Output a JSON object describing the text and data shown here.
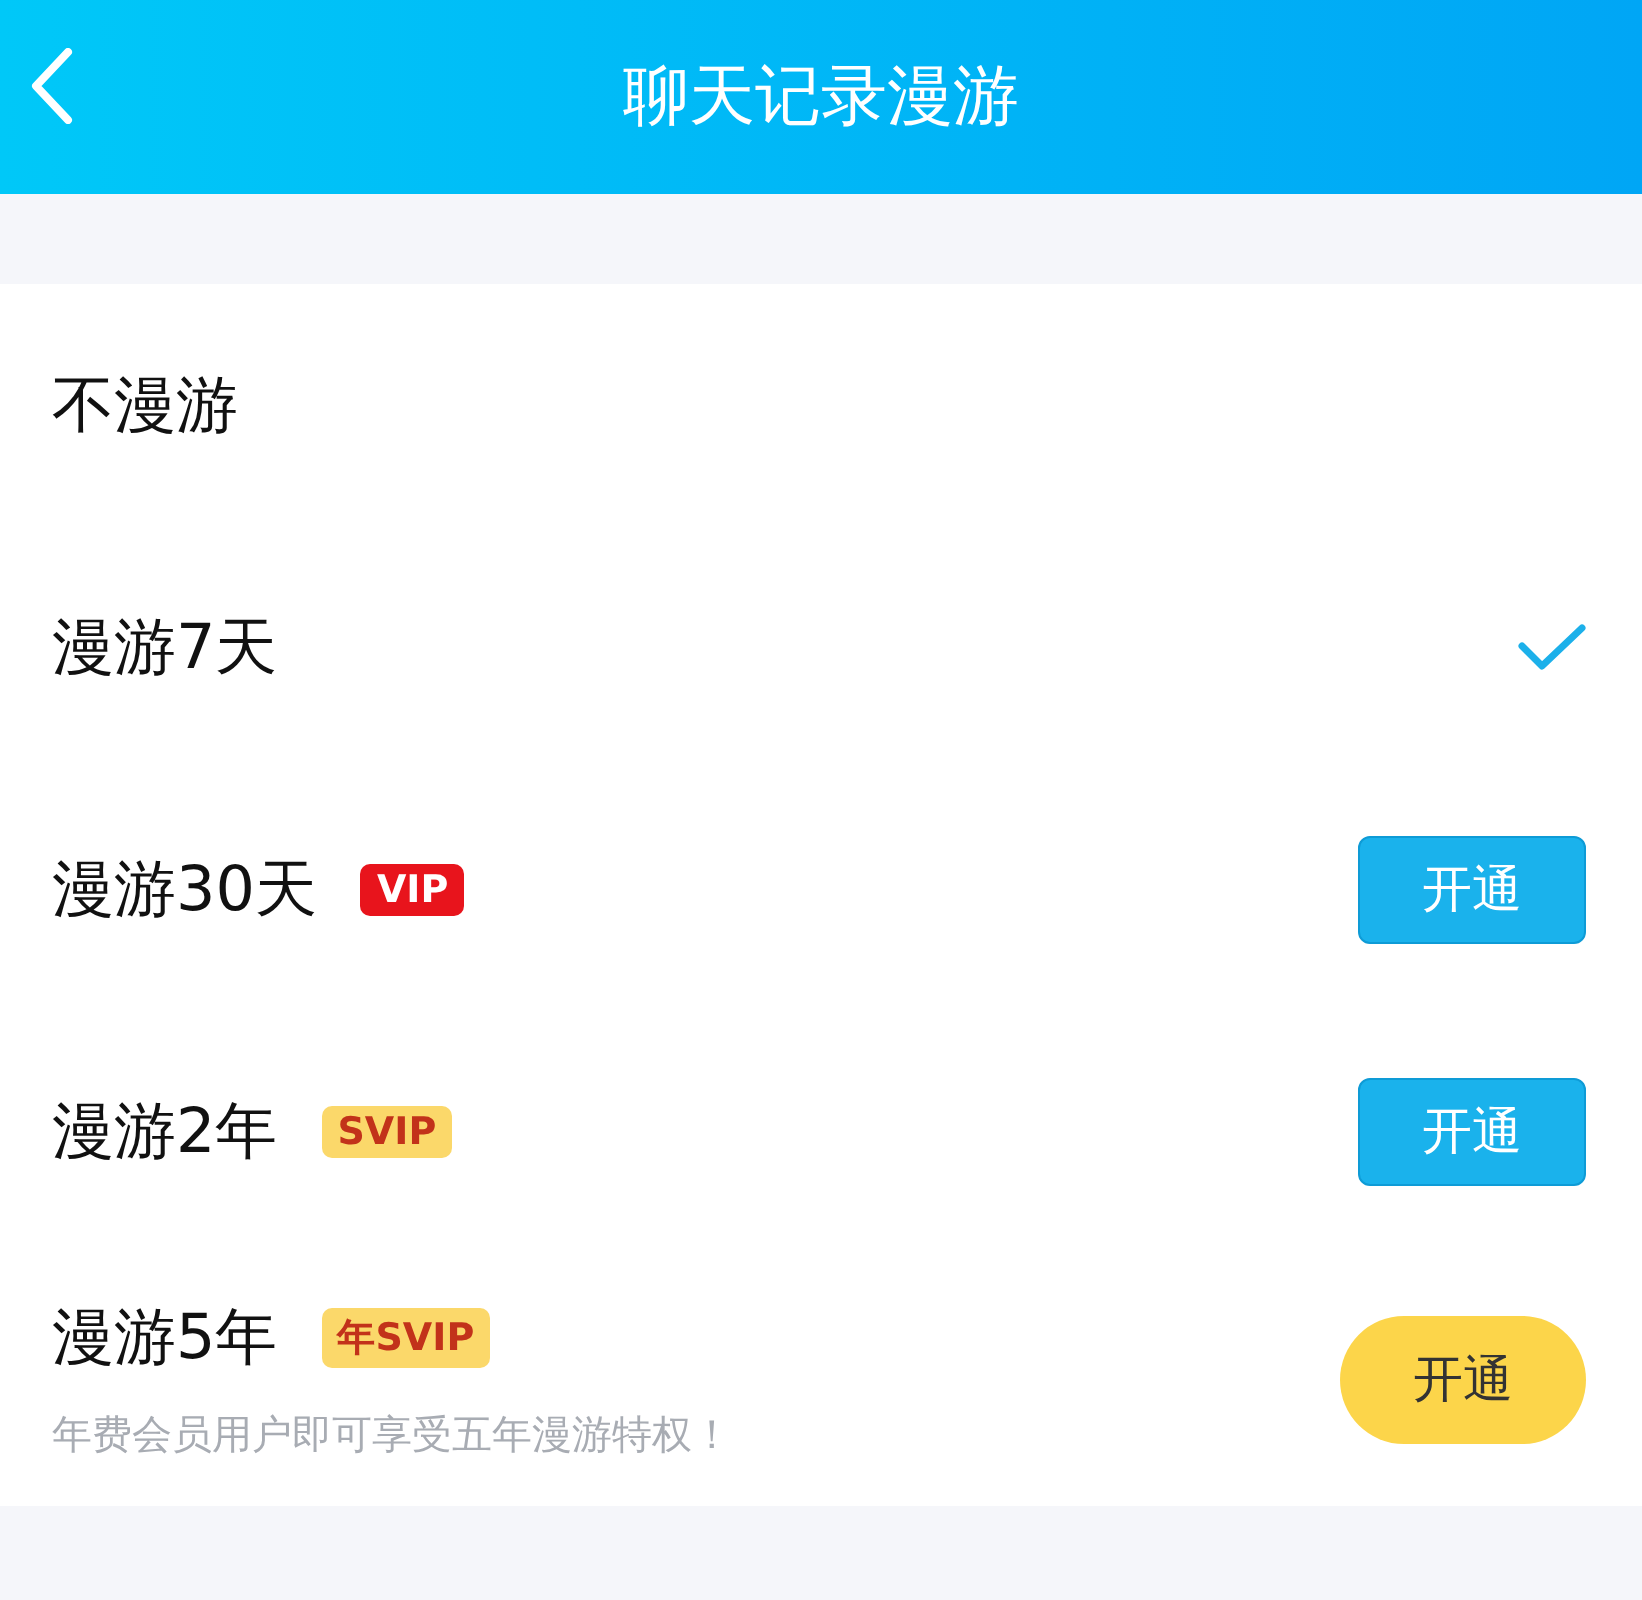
{
  "header": {
    "title": "聊天记录漫游"
  },
  "options": [
    {
      "label": "不漫游",
      "selected": false
    },
    {
      "label": "漫游7天",
      "selected": true
    },
    {
      "label": "漫游30天",
      "selected": false,
      "badge": {
        "kind": "vip",
        "text": "VIP"
      },
      "button": {
        "kind": "blue",
        "text": "开通"
      }
    },
    {
      "label": "漫游2年",
      "selected": false,
      "badge": {
        "kind": "svip",
        "text": "SVIP"
      },
      "button": {
        "kind": "blue",
        "text": "开通"
      }
    },
    {
      "label": "漫游5年",
      "selected": false,
      "badge": {
        "kind": "svip",
        "text": "年SVIP"
      },
      "note": "年费会员用户即可享受五年漫游特权！",
      "button": {
        "kind": "gold",
        "text": "开通"
      }
    }
  ]
}
